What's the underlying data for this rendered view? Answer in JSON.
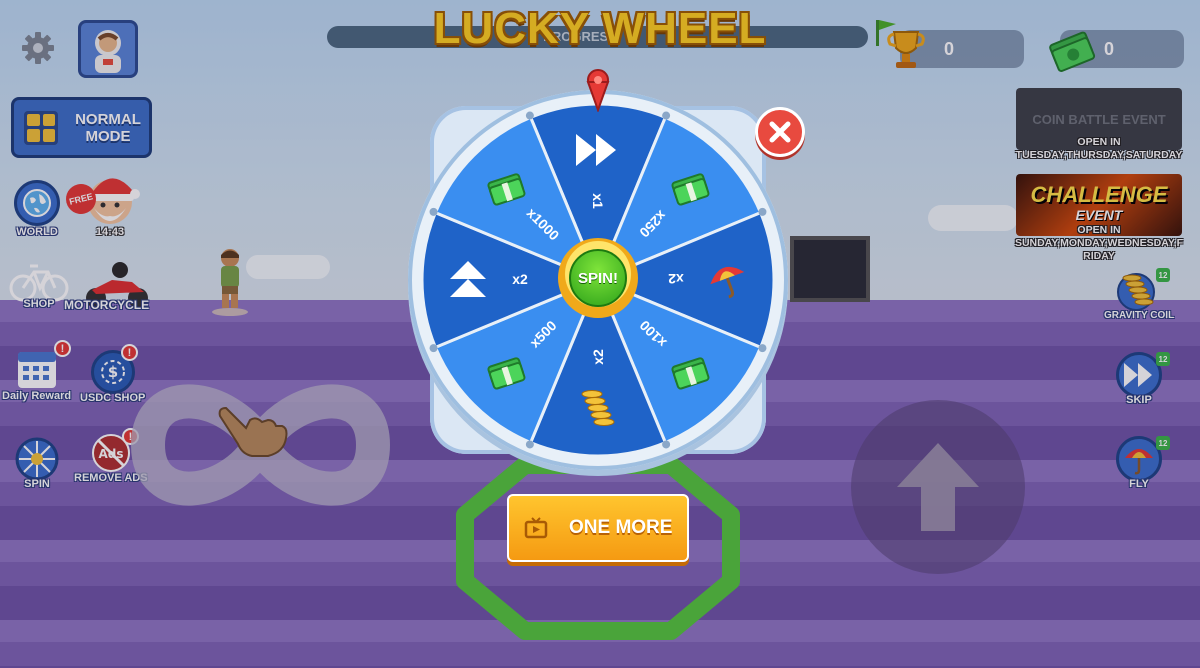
{
  "title": "LUCKY WHEEL",
  "progress_text": "PROGRESS",
  "counters": {
    "trophies": "0",
    "cash": "0"
  },
  "left_menu": {
    "mode_label_line1": "NORMAL",
    "mode_label_line2": "MODE",
    "world": "WORLD",
    "free": "FREE",
    "timer": "14:43",
    "shop": "SHOP",
    "motorcycle": "MOTORCYCLE",
    "daily_reward": "Daily Reward",
    "usdc_shop": "USDC SHOP",
    "spin": "SPIN",
    "remove_ads": "REMOVE ADS",
    "alert_mark": "!"
  },
  "right_menu": {
    "coin_battle_title": "COIN BATTLE EVENT",
    "coin_battle_open": "OPEN IN",
    "coin_battle_days": "TUESDAY,THURSDAY,SATURDAY",
    "challenge_title": "CHALLENGE",
    "challenge_sub": "EVENT",
    "challenge_open": "OPEN IN",
    "challenge_days": "SUNDAY,MONDAY,WEDNESDAY,FRIDAY",
    "gravity_coil": "GRAVITY COIL",
    "skip": "SKIP",
    "fly": "FLY",
    "badge": "12"
  },
  "wheel": {
    "spin_label": "SPIN!",
    "segments": [
      {
        "label": "x1",
        "icon": "fast-forward-icon"
      },
      {
        "label": "x250",
        "icon": "cash-stack-icon"
      },
      {
        "label": "x2",
        "icon": "umbrella-icon"
      },
      {
        "label": "x100",
        "icon": "cash-stack-icon"
      },
      {
        "label": "x2",
        "icon": "spring-coil-icon"
      },
      {
        "label": "x500",
        "icon": "cash-stack-icon"
      },
      {
        "label": "x2",
        "icon": "double-arrow-up-icon"
      },
      {
        "label": "x1000",
        "icon": "cash-stack-icon"
      }
    ]
  },
  "one_more_label": "ONE MORE",
  "colors": {
    "title": "#ffd021",
    "wheel_dark": "#1f63c8",
    "wheel_light": "#3a8ef0",
    "spin": "#2da21a",
    "button": "#f59a12"
  }
}
